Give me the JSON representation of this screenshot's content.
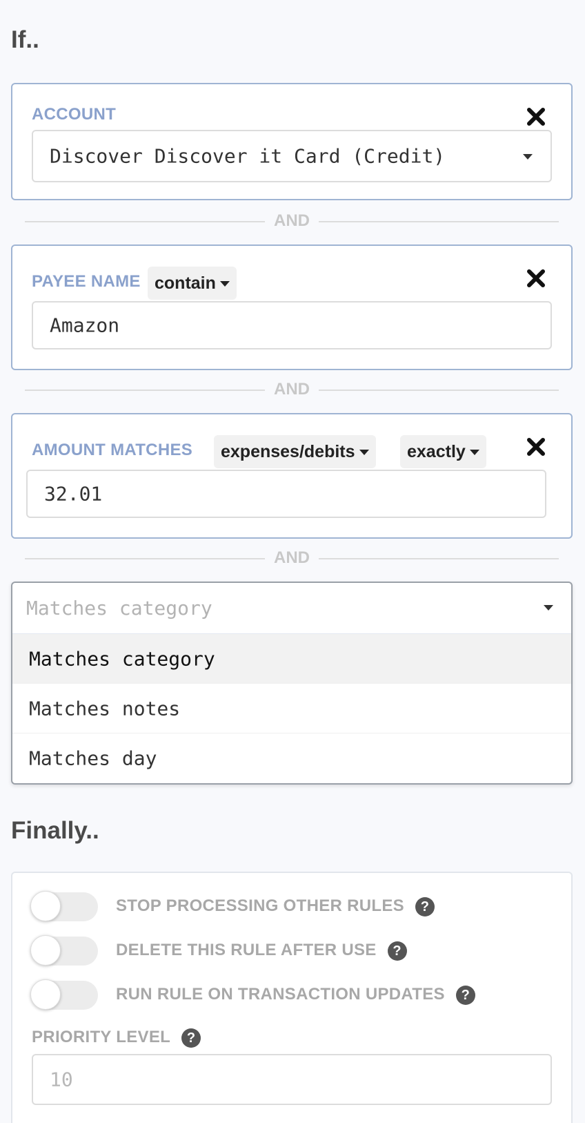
{
  "if_section": {
    "title": "If.."
  },
  "conditions": {
    "account": {
      "label": "ACCOUNT",
      "value": "Discover Discover it Card (Credit)"
    },
    "payee": {
      "label": "PAYEE NAME",
      "operator": "contain",
      "value": "Amazon"
    },
    "amount": {
      "label": "AMOUNT MATCHES",
      "type_selector": "expenses/debits",
      "match_selector": "exactly",
      "value": "32.01"
    }
  },
  "connector": {
    "and_label": "AND"
  },
  "add_condition": {
    "placeholder": "Matches category",
    "options": [
      "Matches category",
      "Matches notes",
      "Matches day"
    ]
  },
  "finally_section": {
    "title": "Finally..",
    "toggles": [
      {
        "label": "STOP PROCESSING OTHER RULES",
        "enabled": false
      },
      {
        "label": "DELETE THIS RULE AFTER USE",
        "enabled": false
      },
      {
        "label": "RUN RULE ON TRANSACTION UPDATES",
        "enabled": false
      }
    ],
    "priority": {
      "label": "PRIORITY LEVEL",
      "placeholder": "10"
    }
  },
  "icons": {
    "close": "close-icon",
    "help": "help-icon",
    "dropdown": "chevron-down-icon"
  }
}
